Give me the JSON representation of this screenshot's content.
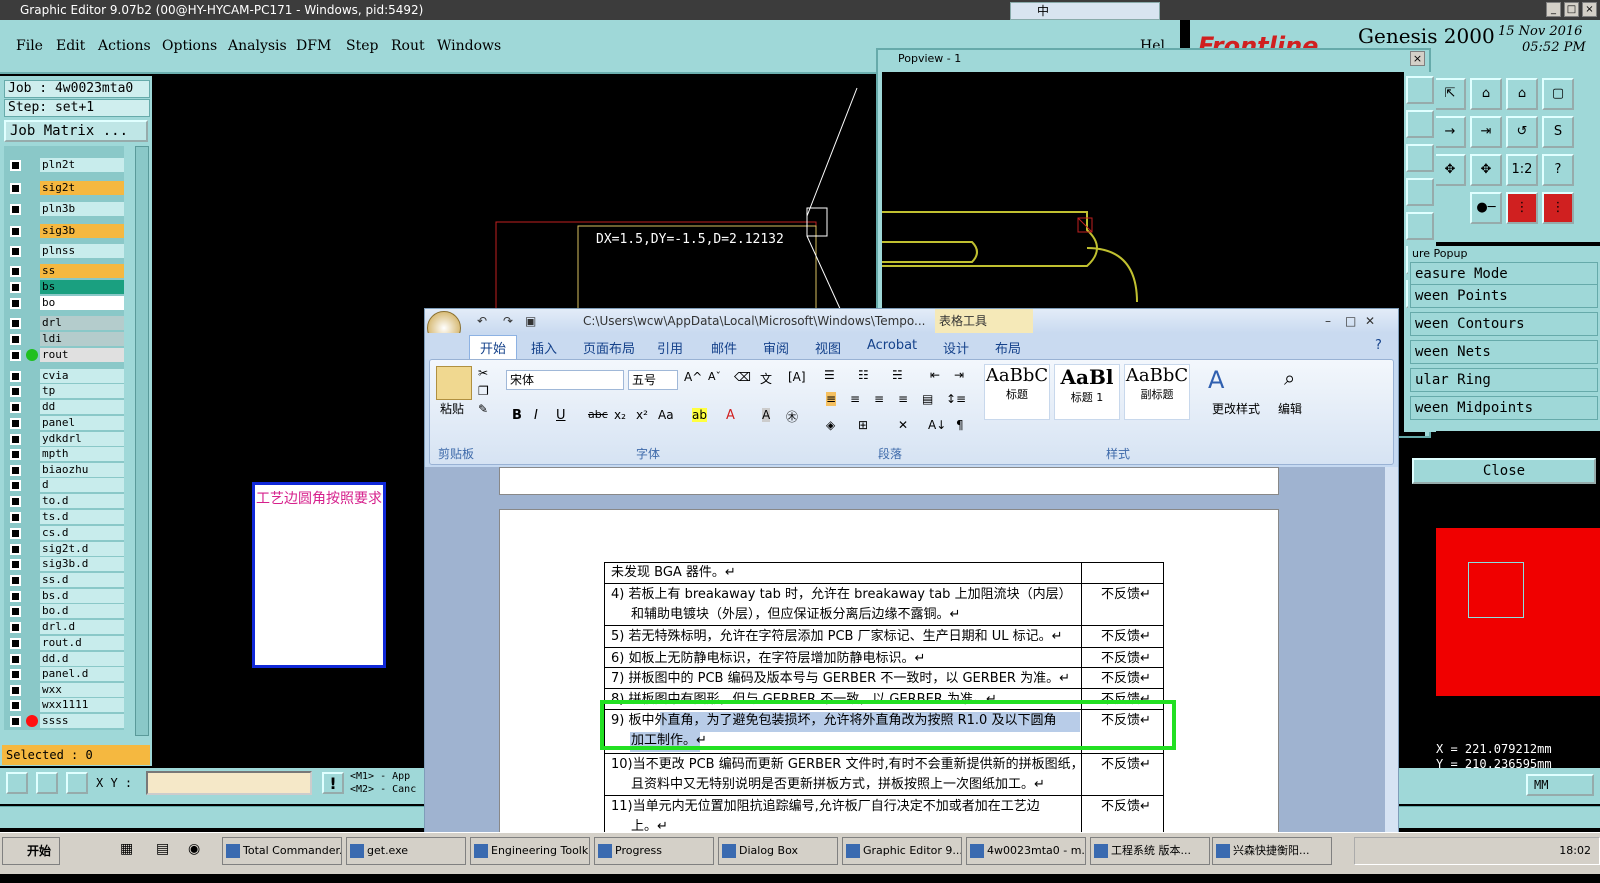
{
  "window": {
    "title": "Graphic Editor 9.07b2 (00@HY-HYCAM-PC171 - Windows, pid:5492)"
  },
  "menu": [
    "File",
    "Edit",
    "Actions",
    "Options",
    "Analysis",
    "DFM",
    "Step",
    "Rout",
    "Windows"
  ],
  "menu_right": "Hel",
  "brand": {
    "name": "Genesis 2000",
    "date": "15 Nov 2016",
    "time": "05:52 PM",
    "logo": "Frontline"
  },
  "job": {
    "job_line": "Job : 4w0023mta0",
    "step_line": "Step: set+1",
    "matrix_button": "Job Matrix ..."
  },
  "layers": [
    {
      "name": "pln2t",
      "style": ""
    },
    {
      "name": "sig2t",
      "style": "y"
    },
    {
      "name": "pln3b",
      "style": ""
    },
    {
      "name": "sig3b",
      "style": "y"
    },
    {
      "name": "plnss",
      "style": ""
    },
    {
      "name": "ss",
      "style": "y"
    },
    {
      "name": "bs",
      "style": "g"
    },
    {
      "name": "bo",
      "style": "w"
    },
    {
      "name": "drl",
      "style": "gr"
    },
    {
      "name": "ldi",
      "style": "gr"
    },
    {
      "name": "rout",
      "style": "sel",
      "dot": "#20c020"
    },
    {
      "name": "cvia",
      "style": ""
    },
    {
      "name": "tp",
      "style": ""
    },
    {
      "name": "dd",
      "style": ""
    },
    {
      "name": "panel",
      "style": ""
    },
    {
      "name": "ydkdrl",
      "style": ""
    },
    {
      "name": "mpth",
      "style": ""
    },
    {
      "name": "biaozhu",
      "style": ""
    },
    {
      "name": "d",
      "style": ""
    },
    {
      "name": "to.d",
      "style": ""
    },
    {
      "name": "ts.d",
      "style": ""
    },
    {
      "name": "cs.d",
      "style": ""
    },
    {
      "name": "sig2t.d",
      "style": ""
    },
    {
      "name": "sig3b.d",
      "style": ""
    },
    {
      "name": "ss.d",
      "style": ""
    },
    {
      "name": "bs.d",
      "style": ""
    },
    {
      "name": "bo.d",
      "style": ""
    },
    {
      "name": "drl.d",
      "style": ""
    },
    {
      "name": "rout.d",
      "style": ""
    },
    {
      "name": "dd.d",
      "style": ""
    },
    {
      "name": "panel.d",
      "style": ""
    },
    {
      "name": "wxx",
      "style": ""
    },
    {
      "name": "wxx1111",
      "style": ""
    },
    {
      "name": "ssss",
      "style": "",
      "dot": "#ff1010"
    }
  ],
  "selected_label": "Selected : 0",
  "canvas": {
    "measure_text": "DX=1.5,DY=-1.5,D=2.12132",
    "note": "工艺边圆角按照要求"
  },
  "popview": {
    "title": "Popview - 1"
  },
  "measure_popup": {
    "title": "ure Popup",
    "items": [
      "easure Mode",
      "ween Points",
      "ween Contours",
      "ween Nets",
      "ular Ring",
      "ween Midpoints"
    ],
    "close": "Close"
  },
  "coords": {
    "x": "X = 221.079212mm",
    "y": "Y = 210.236595mm"
  },
  "units": "MM",
  "xy_label": "X Y :",
  "mouse_hints": [
    "<M1> - App",
    "<M2> - Canc"
  ],
  "word": {
    "title": "C:\\Users\\wcw\\AppData\\Local\\Microsoft\\Windows\\Tempo...",
    "table_tools": "表格工具",
    "tabs": [
      "开始",
      "插入",
      "页面布局",
      "引用",
      "邮件",
      "审阅",
      "视图",
      "Acrobat",
      "设计",
      "布局"
    ],
    "font": "宋体",
    "size": "五号",
    "styles": [
      "标题",
      "标题 1",
      "副标题"
    ],
    "style_sample": [
      "AaBbC",
      "AaBl",
      "AaBbC"
    ],
    "change_styles": "更改样式",
    "edit": "编辑",
    "paste": "粘贴",
    "groups": [
      "剪贴板",
      "字体",
      "段落",
      "样式"
    ],
    "rows": [
      {
        "text": "未发现 BGA 器件。↵",
        "status": ""
      },
      {
        "text": "4) 若板上有 breakaway tab 时，允许在 breakaway tab 上加阻流块（内层）",
        "text2": "和辅助电镀块（外层），但应保证板分离后边缘不露铜。↵",
        "status": "不反馈↵"
      },
      {
        "text": "5) 若无特殊标明，允许在字符层添加 PCB 厂家标记、生产日期和 UL 标记。↵",
        "status": "不反馈↵"
      },
      {
        "text": "6) 如板上无防静电标识，在字符层增加防静电标识。↵",
        "status": "不反馈↵"
      },
      {
        "text": "7) 拼板图中的 PCB 编码及版本号与 GERBER 不一致时，以 GERBER 为准。↵",
        "status": "不反馈↵"
      },
      {
        "text": "8) 拼板图中有图形，但与 GERBER 不一致，以 GERBER 为准。↵",
        "status": "不反馈↵"
      },
      {
        "text": "9) 板中外直角，为了避免包装损坏，允许将外直角改为按照 R1.0 及以下圆角",
        "text2": "加工制作。↵",
        "status": "不反馈↵"
      },
      {
        "text": "10)当不更改 PCB 编码而更新 GERBER 文件时,有时不会重新提供新的拼板图纸，",
        "text2": "且资料中又无特别说明是否更新拼板方式，拼板按照上一次图纸加工。↵",
        "status": "不反馈↵"
      },
      {
        "text": "11)当单元内无位置加阻抗追踪编号,允许板厂自行决定不加或者加在工艺边",
        "text2": "上。↵",
        "status": "不反馈↵"
      }
    ]
  },
  "taskbar": {
    "start": "开始",
    "tasks": [
      "Total Commander...",
      "get.exe",
      "Engineering Toolk...",
      "Progress",
      "Dialog Box",
      "Graphic Editor 9....",
      "4w0023mta0 - m...",
      "工程系统  版本...",
      "兴森快捷衡阳..."
    ],
    "clock": "18:02"
  },
  "ime_bar": "中"
}
